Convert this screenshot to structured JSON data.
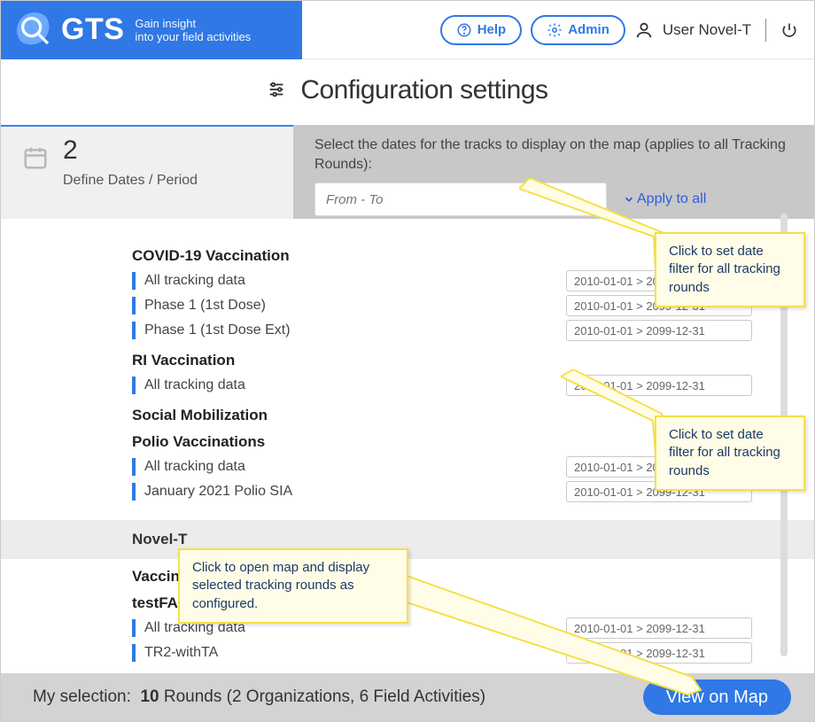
{
  "brand": {
    "name": "GTS",
    "tagline": "Gain insight\ninto your field activities"
  },
  "header": {
    "help": "Help",
    "admin": "Admin",
    "user": "User Novel-T"
  },
  "page_title": "Configuration settings",
  "step": {
    "number": "2",
    "label": "Define Dates / Period",
    "instruction": "Select the dates for the tracks to display on the map (applies to all Tracking Rounds):",
    "from_to_placeholder": "From - To",
    "apply_all": "Apply to all"
  },
  "groups": [
    {
      "title": "COVID-19 Vaccination",
      "rows": [
        {
          "label": "All tracking data",
          "range": "2010-01-01 > 2099-12-31"
        },
        {
          "label": "Phase 1 (1st Dose)",
          "range": "2010-01-01 > 2099-12-31"
        },
        {
          "label": "Phase 1 (1st Dose Ext)",
          "range": "2010-01-01 > 2099-12-31"
        }
      ]
    },
    {
      "title": "RI Vaccination",
      "rows": [
        {
          "label": "All tracking data",
          "range": "2010-01-01 > 2099-12-31"
        }
      ]
    },
    {
      "title": "Social Mobilization",
      "rows": []
    },
    {
      "title": "Polio Vaccinations",
      "rows": [
        {
          "label": "All tracking data",
          "range": "2010-01-01 > 2099-12-31"
        },
        {
          "label": "January 2021 Polio SIA",
          "range": "2010-01-01 > 2099-12-31"
        }
      ]
    }
  ],
  "org_header": "Novel-T",
  "org_groups": [
    {
      "title": "Vaccination Campaign",
      "rows": []
    },
    {
      "title": "testFA_YM",
      "rows": [
        {
          "label": "All tracking data",
          "range": "2010-01-01 > 2099-12-31"
        },
        {
          "label": "TR2-withTA",
          "range": "2010-01-01 > 2099-12-31"
        }
      ]
    }
  ],
  "footer": {
    "prefix": "My selection:",
    "count": "10",
    "rest": "Rounds (2 Organizations, 6 Field Activities)",
    "button": "View on Map"
  },
  "callouts": {
    "a": "Click to set date filter for all tracking rounds",
    "b": "Click to set date filter for all tracking rounds",
    "c": "Click to open map and display selected tracking rounds as configured."
  }
}
